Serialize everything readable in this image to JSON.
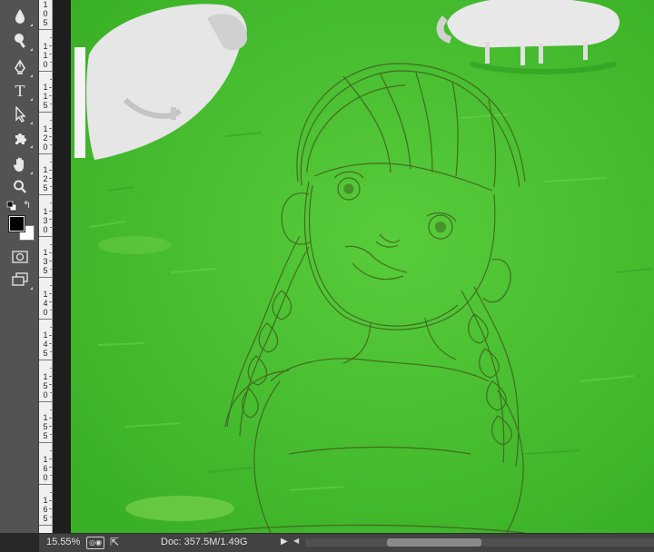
{
  "toolbar": {
    "tools": [
      {
        "name": "blur-tool",
        "icon": "droplet-icon"
      },
      {
        "name": "dodge-tool",
        "icon": "dodge-icon"
      },
      {
        "name": "pen-tool",
        "icon": "pen-icon"
      },
      {
        "name": "type-tool",
        "icon": "type-icon",
        "glyph": "T"
      },
      {
        "name": "path-selection-tool",
        "icon": "cursor-arrow-icon"
      },
      {
        "name": "custom-shape-tool",
        "icon": "puzzle-shape-icon"
      },
      {
        "name": "hand-tool",
        "icon": "hand-icon"
      },
      {
        "name": "zoom-tool",
        "icon": "magnifier-icon"
      }
    ],
    "foreground_color": "#000000",
    "background_color": "#ffffff",
    "swap_glyph": "↰",
    "quick_mask_icon": "quick-mask-icon",
    "screen_mode_icon": "screen-mode-icon"
  },
  "ruler": {
    "labels": [
      "105",
      "110",
      "115",
      "120",
      "125",
      "130",
      "135",
      "140",
      "145",
      "150",
      "155",
      "160",
      "165"
    ]
  },
  "canvas": {
    "subject": "pencil sketch of girl with braids over green meadow with white sheep",
    "grass_color": "#4bc031",
    "sketch_color": "#3a5a1c"
  },
  "status": {
    "zoom": "15.55%",
    "doc_size": "Doc: 357.5M/1.49G",
    "arrow": "▶",
    "scroll_left": "◀"
  }
}
